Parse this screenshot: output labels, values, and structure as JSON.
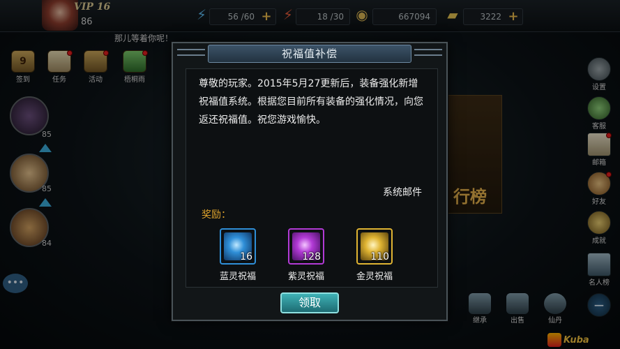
{
  "hud": {
    "vip": "VIP 16",
    "level": "86",
    "energy": "56 /60",
    "stamina": "18 /30",
    "coins": "667094",
    "ingots": "3222",
    "tip": "那儿等着你呢！"
  },
  "left_menu": [
    {
      "label": "签到",
      "badge": "9"
    },
    {
      "label": "任务"
    },
    {
      "label": "活动"
    },
    {
      "label": "梧桐雨"
    }
  ],
  "heroes": [
    {
      "level": "85"
    },
    {
      "level": "85"
    },
    {
      "level": "84"
    }
  ],
  "right_menu": [
    "设置",
    "客服",
    "邮箱",
    "好友",
    "成就",
    "名人榜"
  ],
  "bottom_menu": [
    "继承",
    "出售",
    "仙丹"
  ],
  "rank_text": "行榜",
  "watermark": "Kuba",
  "dialog": {
    "title": "祝福值补偿",
    "message": "尊敬的玩家。2015年5月27更新后，装备强化新增祝福值系统。根据您目前所有装备的强化情况，向您返还祝福值。祝您游戏愉快。",
    "sender": "系统邮件",
    "reward_label": "奖励：",
    "rewards": [
      {
        "name": "蓝灵祝福",
        "count": "16",
        "color": "#2f8fd8"
      },
      {
        "name": "紫灵祝福",
        "count": "128",
        "color": "#b23ad6"
      },
      {
        "name": "金灵祝福",
        "count": "110",
        "color": "#e0b432"
      }
    ],
    "claim_label": "领取"
  }
}
